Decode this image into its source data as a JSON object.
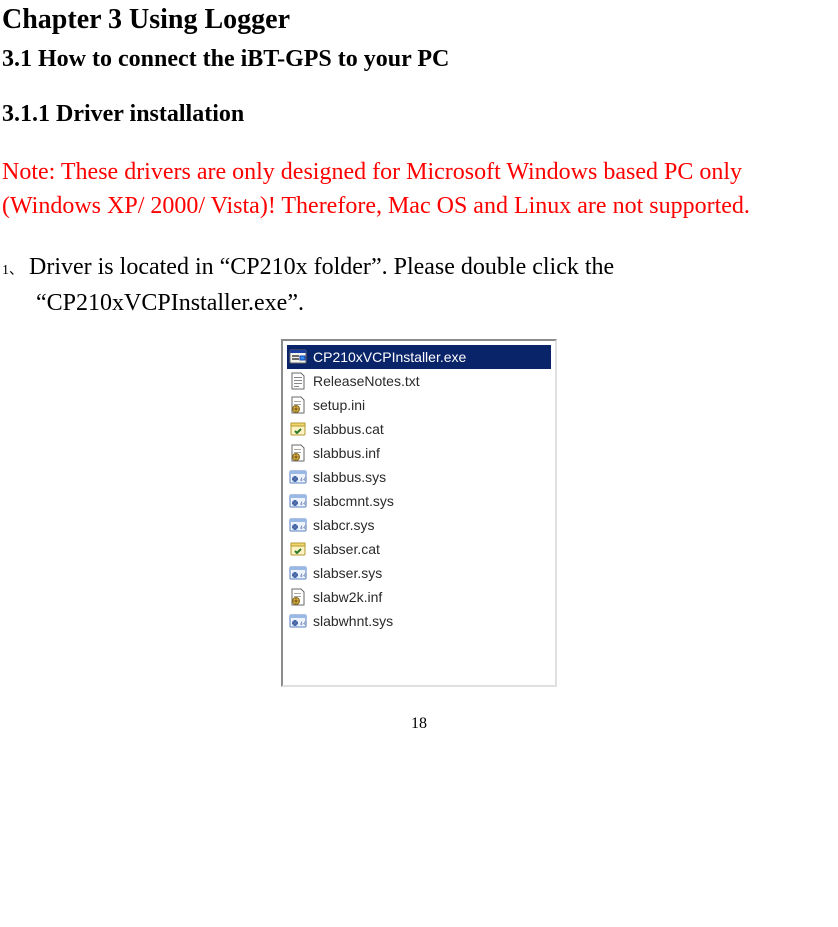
{
  "chapter_title": "Chapter 3 Using Logger",
  "section_title": "3.1 How to connect the iBT-GPS to your PC",
  "subsection_title": "3.1.1 Driver installation",
  "note_text": "Note: These drivers are only designed for Microsoft Windows based PC only (Windows XP/ 2000/ Vista)! Therefore, Mac OS and Linux are not supported.",
  "list": {
    "marker": "1、",
    "text_prefix": "Driver is located in ",
    "q1_open": "“",
    "q1_text": "CP210x folder",
    "q1_close": "”",
    "text_mid": ". Please double click the ",
    "q2_open": "“",
    "q2_text": "CP210xVCPInstaller.exe",
    "q2_close": "”",
    "text_suffix": "."
  },
  "files": [
    {
      "name": "CP210xVCPInstaller.exe",
      "icon": "exe",
      "selected": true
    },
    {
      "name": "ReleaseNotes.txt",
      "icon": "txt",
      "selected": false
    },
    {
      "name": "setup.ini",
      "icon": "ini",
      "selected": false
    },
    {
      "name": "slabbus.cat",
      "icon": "cat",
      "selected": false
    },
    {
      "name": "slabbus.inf",
      "icon": "ini",
      "selected": false
    },
    {
      "name": "slabbus.sys",
      "icon": "sys",
      "selected": false
    },
    {
      "name": "slabcmnt.sys",
      "icon": "sys",
      "selected": false
    },
    {
      "name": "slabcr.sys",
      "icon": "sys",
      "selected": false
    },
    {
      "name": "slabser.cat",
      "icon": "cat",
      "selected": false
    },
    {
      "name": "slabser.sys",
      "icon": "sys",
      "selected": false
    },
    {
      "name": "slabw2k.inf",
      "icon": "ini",
      "selected": false
    },
    {
      "name": "slabwhnt.sys",
      "icon": "sys",
      "selected": false
    }
  ],
  "page_number": "18"
}
